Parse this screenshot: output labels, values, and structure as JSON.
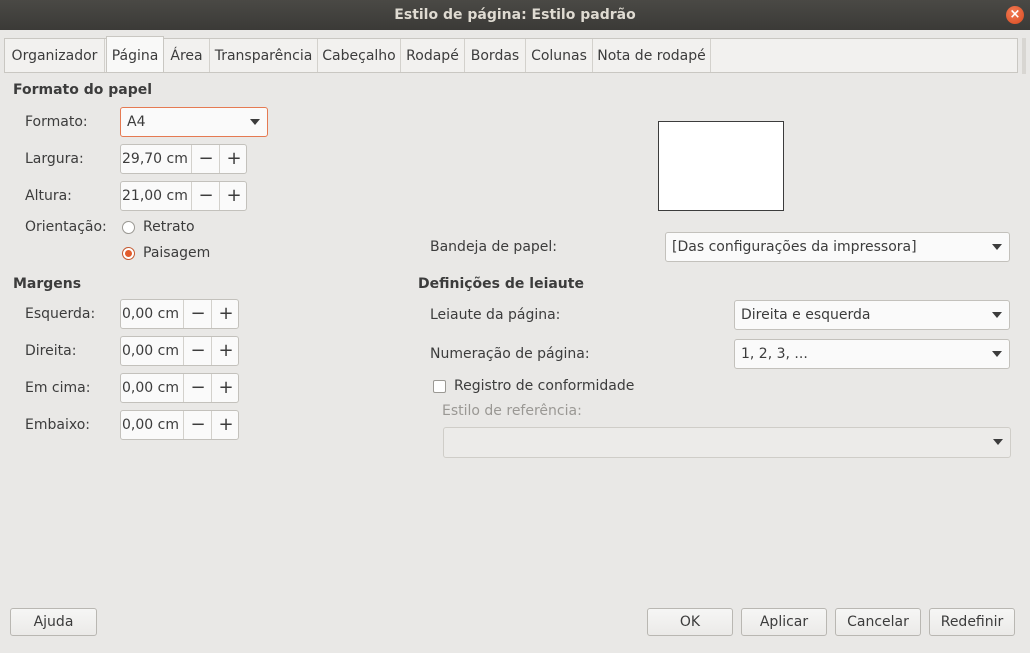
{
  "window": {
    "title": "Estilo de página: Estilo padrão",
    "close": "×"
  },
  "tabs": [
    {
      "label": "Organizador"
    },
    {
      "label": "Página"
    },
    {
      "label": "Área"
    },
    {
      "label": "Transparência"
    },
    {
      "label": "Cabeçalho"
    },
    {
      "label": "Rodapé"
    },
    {
      "label": "Bordas"
    },
    {
      "label": "Colunas"
    },
    {
      "label": "Nota de rodapé"
    }
  ],
  "paper_format": {
    "title": "Formato do papel",
    "format_label": "Formato:",
    "format_value": "A4",
    "width_label": "Largura:",
    "width_value": "29,70 cm",
    "height_label": "Altura:",
    "height_value": "21,00 cm",
    "orientation_label": "Orientação:",
    "portrait_label": "Retrato",
    "landscape_label": "Paisagem",
    "selected_orientation": "Paisagem",
    "tray_label": "Bandeja de papel:",
    "tray_value": "[Das configurações da impressora]"
  },
  "margins": {
    "title": "Margens",
    "left_label": "Esquerda:",
    "left_value": "0,00 cm",
    "right_label": "Direita:",
    "right_value": "0,00 cm",
    "top_label": "Em cima:",
    "top_value": "0,00 cm",
    "bottom_label": "Embaixo:",
    "bottom_value": "0,00 cm"
  },
  "layout": {
    "title": "Definições de leiaute",
    "page_layout_label": "Leiaute da página:",
    "page_layout_value": "Direita e esquerda",
    "numbering_label": "Numeração de página:",
    "numbering_value": "1, 2, 3, ...",
    "register_label": "Registro de conformidade",
    "register_checked": false,
    "ref_style_label": "Estilo de referência:",
    "ref_style_value": ""
  },
  "spin": {
    "minus": "−",
    "plus": "+"
  },
  "buttons": {
    "help": "Ajuda",
    "ok": "OK",
    "apply": "Aplicar",
    "cancel": "Cancelar",
    "reset": "Redefinir"
  },
  "colors": {
    "accent": "#e25c2c",
    "titlebar": "#3b3a37",
    "background": "#e9e8e6"
  }
}
